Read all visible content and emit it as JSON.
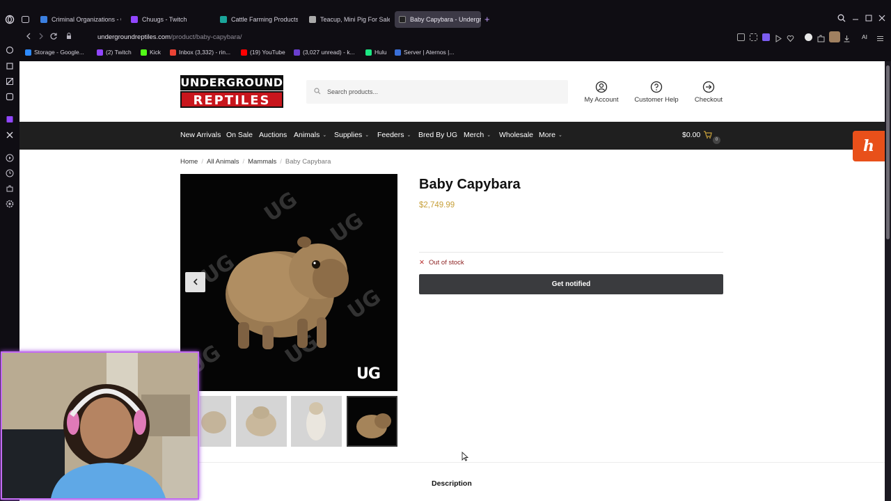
{
  "browser": {
    "tabs": [
      {
        "label": "Criminal Organizations - G",
        "fav": "#3b7fe0",
        "active": false
      },
      {
        "label": "Chuugs - Twitch",
        "fav": "#9146ff",
        "active": false
      },
      {
        "label": "Cattle Farming Products |",
        "fav": "#1aa59a",
        "active": false
      },
      {
        "label": "Teacup, Mini Pig For Sale",
        "fav": "#aaaaaa",
        "active": false
      },
      {
        "label": "Baby Capybara - Undergr",
        "fav": "#222222",
        "active": true
      }
    ],
    "new_tab": "+",
    "url_host": "undergroundreptiles.com",
    "url_path": "/product/baby-capybara/",
    "ai_label": "AI",
    "bookmarks": [
      {
        "label": "Storage - Google...",
        "fav": "#2e8bff"
      },
      {
        "label": "(2) Twitch",
        "fav": "#9146ff"
      },
      {
        "label": "Kick",
        "fav": "#53fc18"
      },
      {
        "label": "Inbox (3,332) - rin...",
        "fav": "#ea4335"
      },
      {
        "label": "(19) YouTube",
        "fav": "#ff0000"
      },
      {
        "label": "(3,027 unread) - k...",
        "fav": "#6a3fcf"
      },
      {
        "label": "Hulu",
        "fav": "#1ce783"
      },
      {
        "label": "Server | Aternos |...",
        "fav": "#3a6fd8"
      }
    ]
  },
  "site": {
    "logo_line1": "UNDERGROUND",
    "logo_line2": "REPTILES",
    "search_placeholder": "Search products...",
    "header_links": [
      "My Account",
      "Customer Help",
      "Checkout"
    ],
    "nav": [
      {
        "label": "New Arrivals",
        "caret": false
      },
      {
        "label": "On Sale",
        "caret": false
      },
      {
        "label": "Auctions",
        "caret": false
      },
      {
        "label": "Animals",
        "caret": true
      },
      {
        "label": "Supplies",
        "caret": true
      },
      {
        "label": "Feeders",
        "caret": true
      },
      {
        "label": "Bred By UG",
        "caret": false
      },
      {
        "label": "Merch",
        "caret": true
      },
      {
        "label": "Wholesale",
        "caret": false
      },
      {
        "label": "More",
        "caret": true
      }
    ],
    "cart_total": "$0.00",
    "cart_count": "0",
    "honey_label": "h",
    "breadcrumb": [
      "Home",
      "All Animals",
      "Mammals",
      "Baby Capybara"
    ],
    "product": {
      "title": "Baby Capybara",
      "price": "$2,749.99",
      "stock_status": "Out of stock",
      "notify_button": "Get notified",
      "watermark_badge": "UG"
    },
    "tabs": {
      "description": "Description"
    }
  },
  "colors": {
    "accent_price": "#c7a03a",
    "nav_bg": "#1f1f1f",
    "stock_red": "#8b1e1e",
    "webcam_border": "#c36cf2"
  }
}
